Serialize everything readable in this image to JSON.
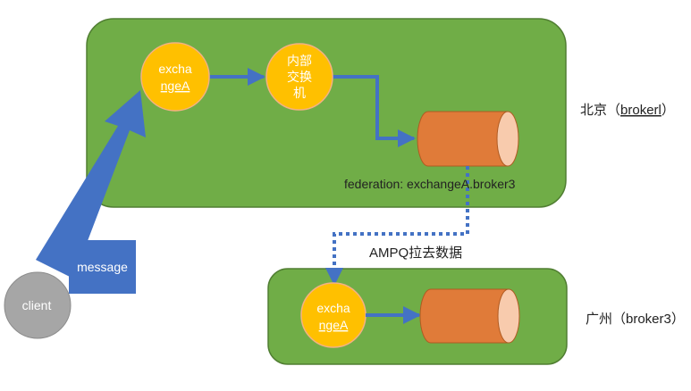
{
  "beijing": {
    "label_prefix": "北京（",
    "label_broker": "brokerl",
    "label_suffix": "）",
    "exchange_label_line1": "excha",
    "exchange_label_line2": "ngeA",
    "internal_exchange_line1": "内部",
    "internal_exchange_line2": "交换",
    "internal_exchange_line3": "机",
    "federation_label": "federation: exchangeA.broker3"
  },
  "guangzhou": {
    "label": "广州（broker3）",
    "exchange_label_line1": "excha",
    "exchange_label_line2": "ngeA"
  },
  "link_label": "AMPQ拉去数据",
  "client_label": "client",
  "message_label": "message",
  "colors": {
    "region_fill": "#70ad47",
    "region_stroke": "#507e32",
    "exchange_fill": "#ffc000",
    "exchange_stroke": "#f4b183",
    "queue_fill": "#e07b39",
    "queue_cap": "#f8cbad",
    "queue_stroke": "#b05b22",
    "arrow": "#4472c4",
    "client_fill": "#a6a6a6",
    "message_fill": "#4472c4",
    "text_white": "#ffffff",
    "text_dark": "#222222"
  }
}
